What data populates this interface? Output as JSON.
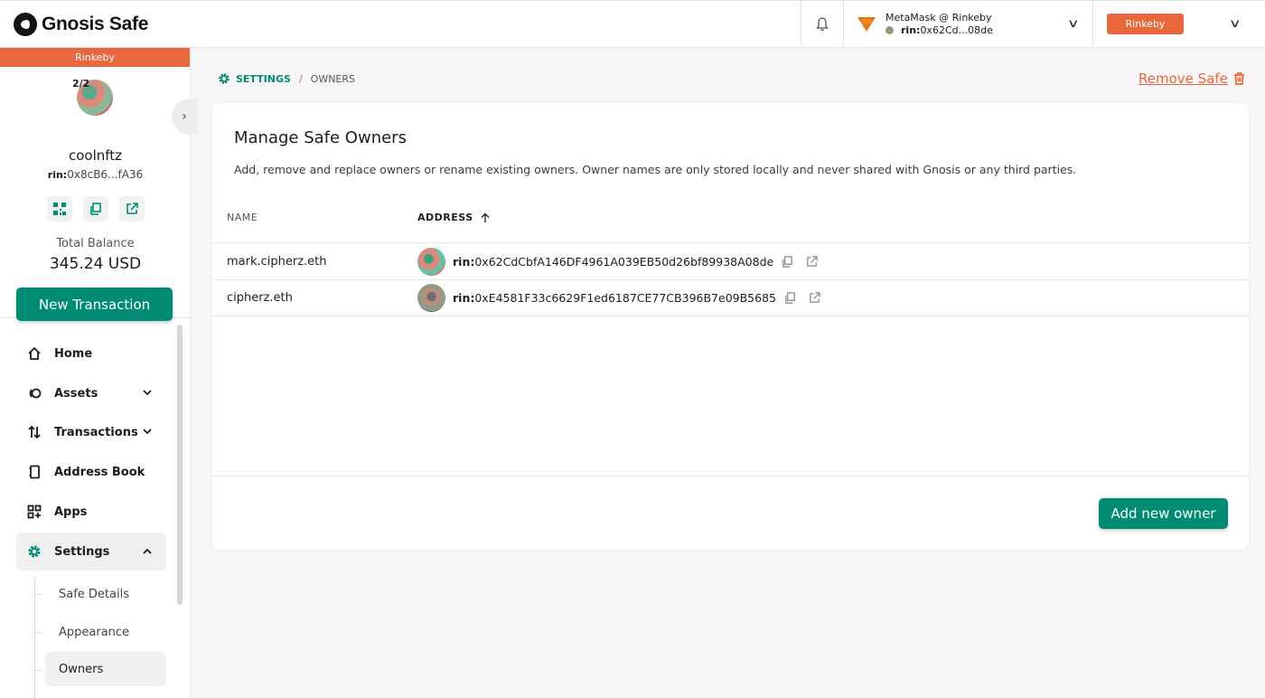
{
  "header": {
    "app_name": "Gnosis Safe",
    "wallet_name": "MetaMask @ Rinkeby",
    "wallet_prefix": "rin:",
    "wallet_address": "0x62Cd...08de",
    "network_badge": "Rinkeby"
  },
  "sidebar": {
    "network_bar": "Rinkeby",
    "threshold": "2/2",
    "safe_name": "coolnftz",
    "safe_prefix": "rin:",
    "safe_address": "0x8cB6...fA36",
    "total_label": "Total Balance",
    "total_value": "345.24 USD",
    "new_tx_label": "New Transaction",
    "nav": [
      {
        "label": "Home",
        "icon": "home-icon"
      },
      {
        "label": "Assets",
        "icon": "assets-icon"
      },
      {
        "label": "Transactions",
        "icon": "transactions-icon"
      },
      {
        "label": "Address Book",
        "icon": "address-book-icon"
      },
      {
        "label": "Apps",
        "icon": "apps-icon"
      },
      {
        "label": "Settings",
        "icon": "settings-icon"
      }
    ],
    "sub_nav": [
      {
        "label": "Safe Details"
      },
      {
        "label": "Appearance"
      },
      {
        "label": "Owners"
      }
    ]
  },
  "main": {
    "breadcrumb": {
      "section": "SETTINGS",
      "separator": "/",
      "page": "OWNERS"
    },
    "remove_safe_label": "Remove Safe",
    "card": {
      "title": "Manage Safe Owners",
      "description": "Add, remove and replace owners or rename existing owners. Owner names are only stored locally and never shared with Gnosis or any third parties.",
      "columns": {
        "name": "NAME",
        "address": "ADDRESS"
      },
      "owners": [
        {
          "name": "mark.cipherz.eth",
          "prefix": "rin:",
          "address": "0x62CdCbfA146DF4961A039EB50d26bf89938A08de"
        },
        {
          "name": "cipherz.eth",
          "prefix": "rin:",
          "address": "0xE4581F33c6629F1ed6187CE77CB396B7e09B5685"
        }
      ],
      "add_owner_label": "Add new owner"
    }
  },
  "colors": {
    "brand_green": "#008c73",
    "network_orange": "#e8673c"
  }
}
